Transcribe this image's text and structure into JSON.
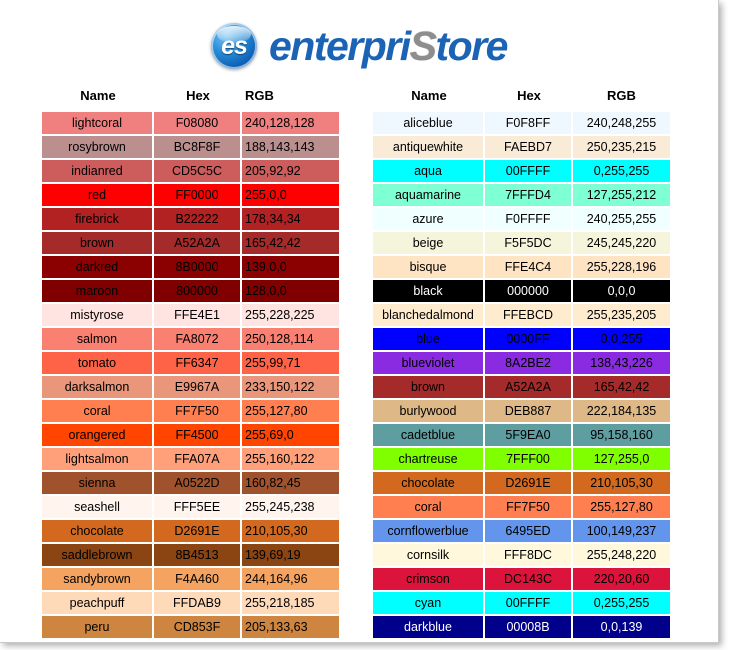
{
  "logo": {
    "badge_text": "es",
    "word_prefix": "enterpri",
    "word_accent": "S",
    "word_suffix": "tore",
    "brand_blue": "#1B63B5",
    "accent_silver": "#8D8D8D"
  },
  "tables": [
    {
      "id": "left-table",
      "rgb_align": "left",
      "headers": {
        "name": "Name",
        "hex": "Hex",
        "rgb": "RGB"
      },
      "rows": [
        {
          "name": "lightcoral",
          "hex": "F08080",
          "rgb": "240,128,128",
          "swatch": "#F08080",
          "light_text": false
        },
        {
          "name": "rosybrown",
          "hex": "BC8F8F",
          "rgb": "188,143,143",
          "swatch": "#BC8F8F",
          "light_text": false
        },
        {
          "name": "indianred",
          "hex": "CD5C5C",
          "rgb": "205,92,92",
          "swatch": "#CD5C5C",
          "light_text": false
        },
        {
          "name": "red",
          "hex": "FF0000",
          "rgb": "255,0,0",
          "swatch": "#FF0000",
          "light_text": false
        },
        {
          "name": "firebrick",
          "hex": "B22222",
          "rgb": "178,34,34",
          "swatch": "#B22222",
          "light_text": false
        },
        {
          "name": "brown",
          "hex": "A52A2A",
          "rgb": "165,42,42",
          "swatch": "#A52A2A",
          "light_text": false
        },
        {
          "name": "darkred",
          "hex": "8B0000",
          "rgb": "139,0,0",
          "swatch": "#8B0000",
          "light_text": false
        },
        {
          "name": "maroon",
          "hex": "800000",
          "rgb": "128,0,0",
          "swatch": "#800000",
          "light_text": false
        },
        {
          "name": "mistyrose",
          "hex": "FFE4E1",
          "rgb": "255,228,225",
          "swatch": "#FFE4E1",
          "light_text": false
        },
        {
          "name": "salmon",
          "hex": "FA8072",
          "rgb": "250,128,114",
          "swatch": "#FA8072",
          "light_text": false
        },
        {
          "name": "tomato",
          "hex": "FF6347",
          "rgb": "255,99,71",
          "swatch": "#FF6347",
          "light_text": false
        },
        {
          "name": "darksalmon",
          "hex": "E9967A",
          "rgb": "233,150,122",
          "swatch": "#E9967A",
          "light_text": false
        },
        {
          "name": "coral",
          "hex": "FF7F50",
          "rgb": "255,127,80",
          "swatch": "#FF7F50",
          "light_text": false
        },
        {
          "name": "orangered",
          "hex": "FF4500",
          "rgb": "255,69,0",
          "swatch": "#FF4500",
          "light_text": false
        },
        {
          "name": "lightsalmon",
          "hex": "FFA07A",
          "rgb": "255,160,122",
          "swatch": "#FFA07A",
          "light_text": false
        },
        {
          "name": "sienna",
          "hex": "A0522D",
          "rgb": "160,82,45",
          "swatch": "#A0522D",
          "light_text": false
        },
        {
          "name": "seashell",
          "hex": "FFF5EE",
          "rgb": "255,245,238",
          "swatch": "#FFF5EE",
          "light_text": false
        },
        {
          "name": "chocolate",
          "hex": "D2691E",
          "rgb": "210,105,30",
          "swatch": "#D2691E",
          "light_text": false
        },
        {
          "name": "saddlebrown",
          "hex": "8B4513",
          "rgb": "139,69,19",
          "swatch": "#8B4513",
          "light_text": false
        },
        {
          "name": "sandybrown",
          "hex": "F4A460",
          "rgb": "244,164,96",
          "swatch": "#F4A460",
          "light_text": false
        },
        {
          "name": "peachpuff",
          "hex": "FFDAB9",
          "rgb": "255,218,185",
          "swatch": "#FFDAB9",
          "light_text": false
        },
        {
          "name": "peru",
          "hex": "CD853F",
          "rgb": "205,133,63",
          "swatch": "#CD853F",
          "light_text": false
        }
      ]
    },
    {
      "id": "right-table",
      "rgb_align": "center",
      "headers": {
        "name": "Name",
        "hex": "Hex",
        "rgb": "RGB"
      },
      "rows": [
        {
          "name": "aliceblue",
          "hex": "F0F8FF",
          "rgb": "240,248,255",
          "swatch": "#F0F8FF",
          "light_text": false
        },
        {
          "name": "antiquewhite",
          "hex": "FAEBD7",
          "rgb": "250,235,215",
          "swatch": "#FAEBD7",
          "light_text": false
        },
        {
          "name": "aqua",
          "hex": "00FFFF",
          "rgb": "0,255,255",
          "swatch": "#00FFFF",
          "light_text": false
        },
        {
          "name": "aquamarine",
          "hex": "7FFFD4",
          "rgb": "127,255,212",
          "swatch": "#7FFFD4",
          "light_text": false
        },
        {
          "name": "azure",
          "hex": "F0FFFF",
          "rgb": "240,255,255",
          "swatch": "#F0FFFF",
          "light_text": false
        },
        {
          "name": "beige",
          "hex": "F5F5DC",
          "rgb": "245,245,220",
          "swatch": "#F5F5DC",
          "light_text": false
        },
        {
          "name": "bisque",
          "hex": "FFE4C4",
          "rgb": "255,228,196",
          "swatch": "#FFE4C4",
          "light_text": false
        },
        {
          "name": "black",
          "hex": "000000",
          "rgb": "0,0,0",
          "swatch": "#000000",
          "light_text": true
        },
        {
          "name": "blanchedalmond",
          "hex": "FFEBCD",
          "rgb": "255,235,205",
          "swatch": "#FFEBCD",
          "light_text": false
        },
        {
          "name": "blue",
          "hex": "0000FF",
          "rgb": "0,0,255",
          "swatch": "#0000FF",
          "light_text": false
        },
        {
          "name": "blueviolet",
          "hex": "8A2BE2",
          "rgb": "138,43,226",
          "swatch": "#8A2BE2",
          "light_text": false
        },
        {
          "name": "brown",
          "hex": "A52A2A",
          "rgb": "165,42,42",
          "swatch": "#A52A2A",
          "light_text": false
        },
        {
          "name": "burlywood",
          "hex": "DEB887",
          "rgb": "222,184,135",
          "swatch": "#DEB887",
          "light_text": false
        },
        {
          "name": "cadetblue",
          "hex": "5F9EA0",
          "rgb": "95,158,160",
          "swatch": "#5F9EA0",
          "light_text": false
        },
        {
          "name": "chartreuse",
          "hex": "7FFF00",
          "rgb": "127,255,0",
          "swatch": "#7FFF00",
          "light_text": false
        },
        {
          "name": "chocolate",
          "hex": "D2691E",
          "rgb": "210,105,30",
          "swatch": "#D2691E",
          "light_text": false
        },
        {
          "name": "coral",
          "hex": "FF7F50",
          "rgb": "255,127,80",
          "swatch": "#FF7F50",
          "light_text": false
        },
        {
          "name": "cornflowerblue",
          "hex": "6495ED",
          "rgb": "100,149,237",
          "swatch": "#6495ED",
          "light_text": false
        },
        {
          "name": "cornsilk",
          "hex": "FFF8DC",
          "rgb": "255,248,220",
          "swatch": "#FFF8DC",
          "light_text": false
        },
        {
          "name": "crimson",
          "hex": "DC143C",
          "rgb": "220,20,60",
          "swatch": "#DC143C",
          "light_text": false
        },
        {
          "name": "cyan",
          "hex": "00FFFF",
          "rgb": "0,255,255",
          "swatch": "#00FFFF",
          "light_text": false
        },
        {
          "name": "darkblue",
          "hex": "00008B",
          "rgb": "0,0,139",
          "swatch": "#00008B",
          "light_text": true
        }
      ]
    }
  ]
}
